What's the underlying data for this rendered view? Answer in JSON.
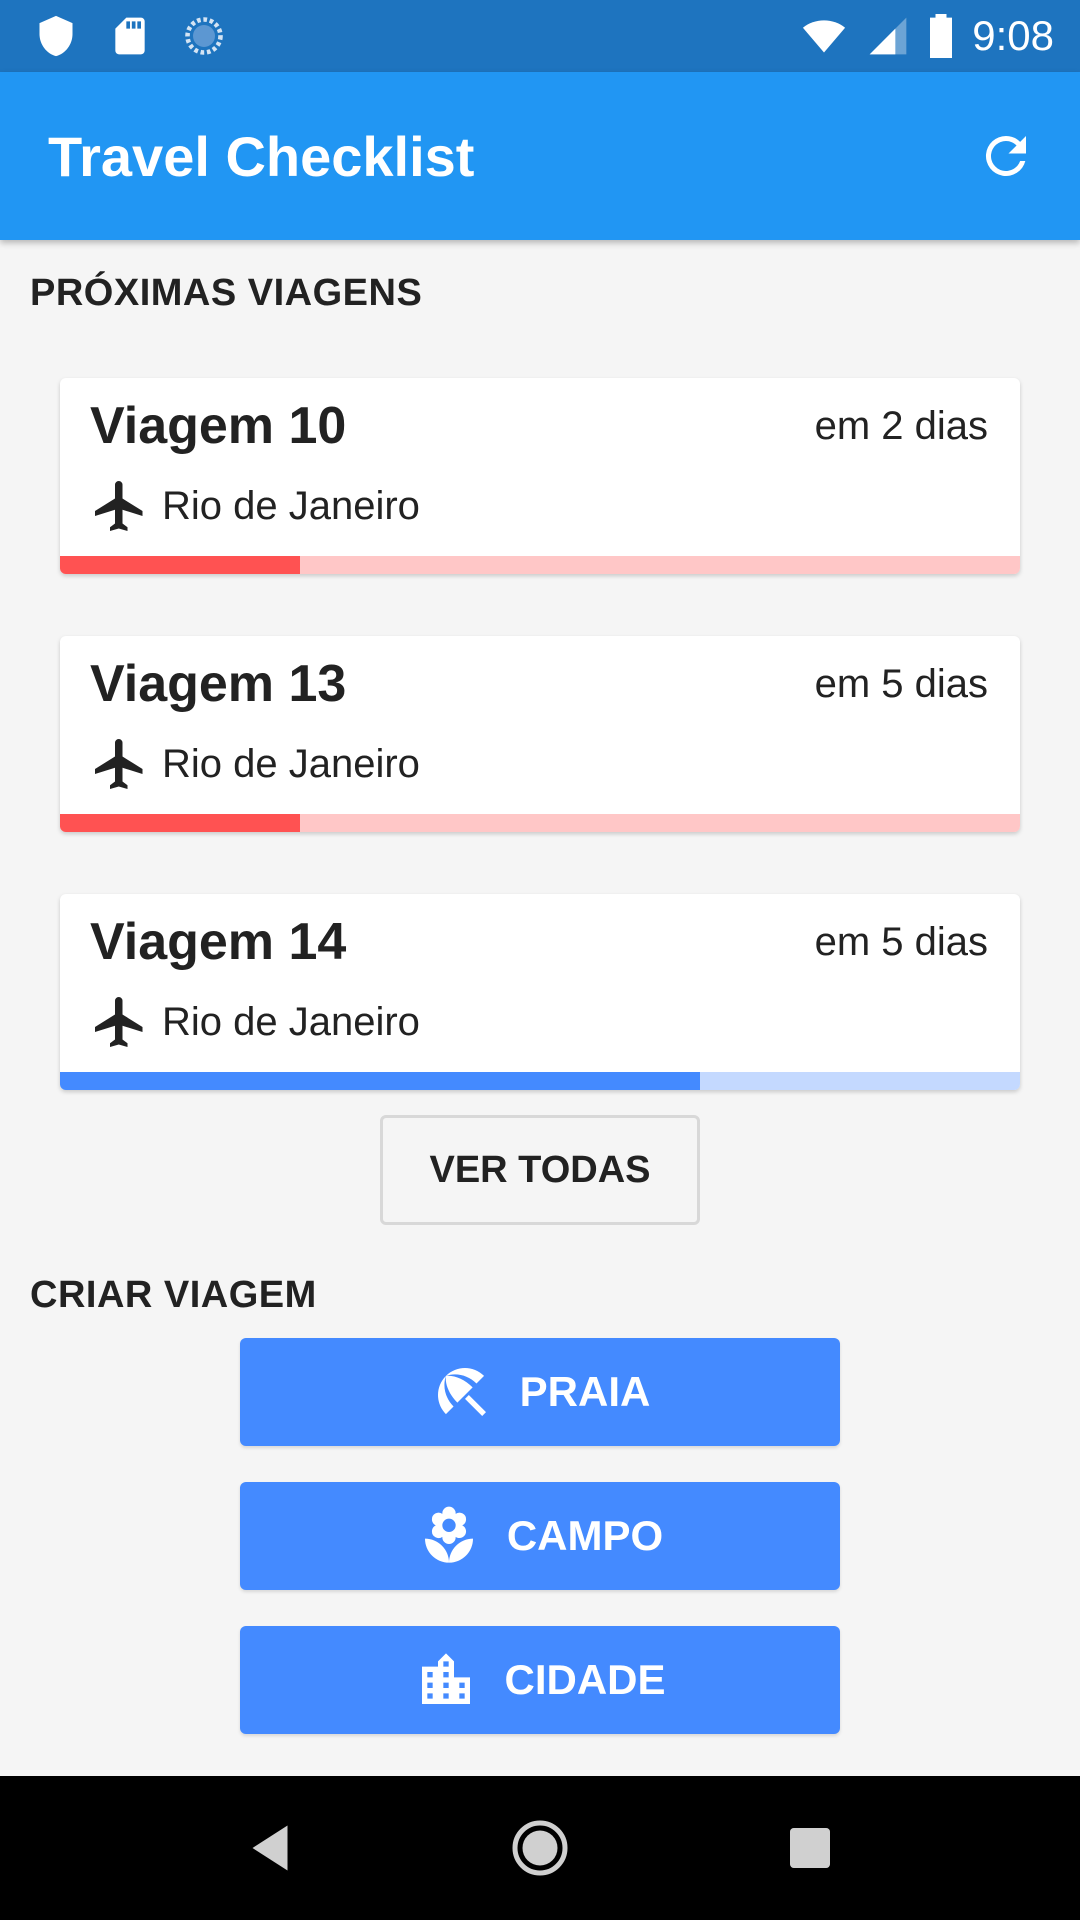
{
  "status_bar": {
    "time": "9:08",
    "icons_left": [
      "shield-icon",
      "sd-card-icon",
      "sync-icon"
    ],
    "icons_right": [
      "wifi-icon",
      "signal-icon",
      "battery-icon"
    ]
  },
  "app_bar": {
    "title": "Travel Checklist",
    "action_icon": "refresh-icon"
  },
  "upcoming": {
    "section_title": "PRÓXIMAS VIAGENS",
    "trips": [
      {
        "title": "Viagem 10",
        "when": "em 2 dias",
        "destination": "Rio de Janeiro",
        "progress": 0.25,
        "color": "#ff5252",
        "track_color": "#ffc7c7"
      },
      {
        "title": "Viagem 13",
        "when": "em 5 dias",
        "destination": "Rio de Janeiro",
        "progress": 0.25,
        "color": "#ff5252",
        "track_color": "#ffc7c7"
      },
      {
        "title": "Viagem 14",
        "when": "em 5 dias",
        "destination": "Rio de Janeiro",
        "progress": 0.667,
        "color": "#448aff",
        "track_color": "#c4d9ff"
      }
    ],
    "see_all_label": "VER TODAS"
  },
  "create": {
    "section_title": "CRIAR VIAGEM",
    "buttons": [
      {
        "label": "PRAIA",
        "icon": "beach-umbrella-icon"
      },
      {
        "label": "CAMPO",
        "icon": "flower-icon"
      },
      {
        "label": "CIDADE",
        "icon": "city-icon"
      }
    ]
  },
  "colors": {
    "status_bar": "#1e74bf",
    "app_bar": "#2196f3",
    "button": "#448aff"
  },
  "nav_bar": {
    "icons": [
      "back-icon",
      "home-icon",
      "recents-icon"
    ]
  }
}
